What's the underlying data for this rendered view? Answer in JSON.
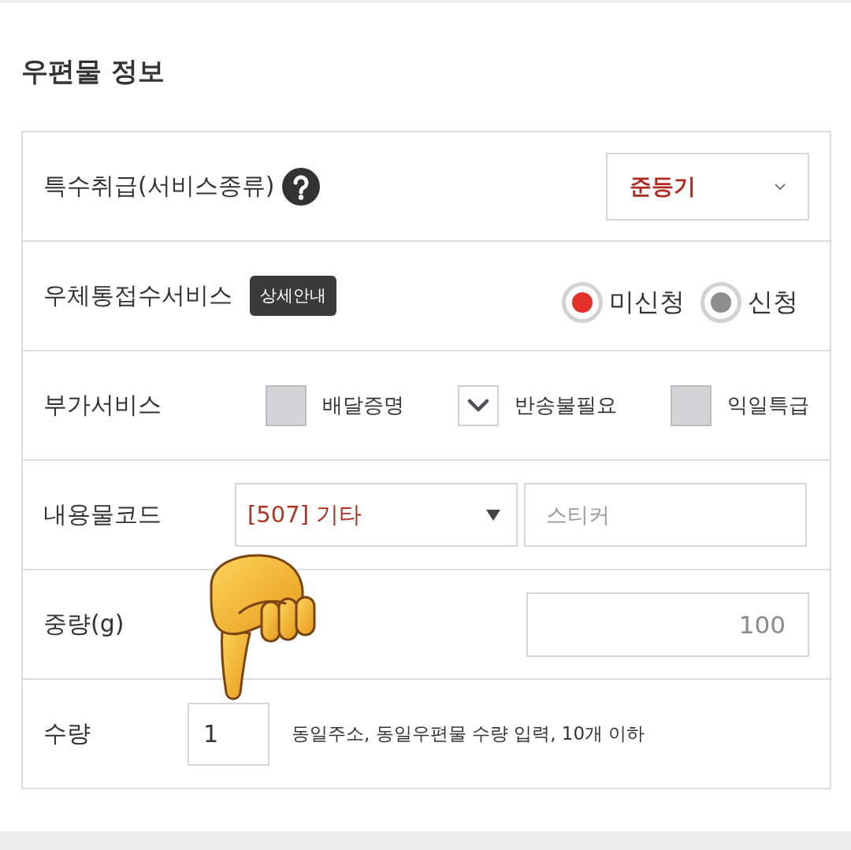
{
  "title": "우편물 정보",
  "rows": [
    {
      "kind": "select",
      "label": "특수취급(서비스종류)",
      "help": true,
      "select": {
        "value": "준등기"
      }
    },
    {
      "kind": "radio",
      "label": "우체통접수서비스",
      "badge": "상세안내",
      "options": [
        {
          "label": "미신청",
          "selected": true
        },
        {
          "label": "신청",
          "selected": false
        }
      ]
    },
    {
      "kind": "checkbox",
      "label": "부가서비스",
      "options": [
        {
          "label": "배달증명",
          "checked": false
        },
        {
          "label": "반송불필요",
          "checked": true
        },
        {
          "label": "익일특급",
          "checked": false
        }
      ]
    },
    {
      "kind": "code",
      "label": "내용물코드",
      "select": {
        "value": "[507] 기타"
      },
      "input": {
        "placeholder": "스티커"
      }
    },
    {
      "kind": "weight",
      "label": "중량(g)",
      "input": {
        "placeholder": "100"
      }
    },
    {
      "kind": "quantity",
      "label": "수량",
      "input": {
        "value": "1"
      },
      "note": "동일주소, 동일우편물 수량 입력, 10개 이하"
    }
  ]
}
